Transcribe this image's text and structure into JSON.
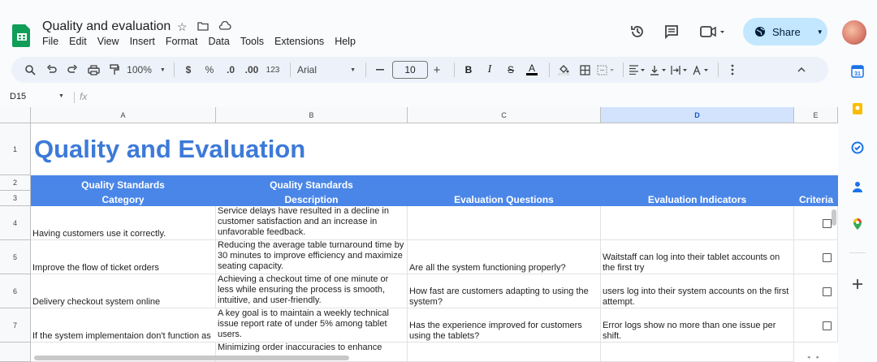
{
  "header": {
    "doc_title": "Quality and evaluation",
    "menu": [
      "File",
      "Edit",
      "View",
      "Insert",
      "Format",
      "Data",
      "Tools",
      "Extensions",
      "Help"
    ],
    "share_label": "Share"
  },
  "toolbar": {
    "zoom": "100%",
    "currency": "$",
    "percent": "%",
    "dec_less": ".0",
    "dec_more": ".00",
    "number_format": "123",
    "font": "Arial",
    "font_size": "10"
  },
  "formula_bar": {
    "name_box": "D15",
    "fx_label": "fx",
    "value": ""
  },
  "columns": [
    "A",
    "B",
    "C",
    "D",
    "E"
  ],
  "rows": [
    "1",
    "2",
    "3",
    "4",
    "5",
    "6",
    "7"
  ],
  "sheet": {
    "title": "Quality and Evaluation",
    "headers": {
      "a_top": "Quality Standards",
      "a_bottom": "Category",
      "b_top": "Quality Standards",
      "b_bottom": "Description",
      "c": "Evaluation Questions",
      "d": "Evaluation Indicators",
      "e": "Criteria"
    },
    "data_rows": [
      {
        "a": "Having customers use it correctly.",
        "b": "Service delays have resulted in a decline in customer satisfaction and an increase in unfavorable feedback.",
        "c": "",
        "d": ""
      },
      {
        "a": "Improve the flow of ticket orders",
        "b": "Reducing the average table turnaround time by 30 minutes to improve efficiency and maximize seating capacity.",
        "c": "Are all the system functioning properly?",
        "d": "Waitstaff can log into their tablet accounts on the first try"
      },
      {
        "a": "Delivery checkout system online",
        "b": "Achieving a checkout time of one minute or less while ensuring the process is smooth, intuitive, and user-friendly.",
        "c": "How fast are customers adapting to using the system?",
        "d": "users log into their system accounts on the first attempt."
      },
      {
        "a": "If the system implementaion don't function as",
        "b": "A key goal is to maintain a weekly technical issue report rate of under 5% among tablet users.",
        "c": "Has the experience improved for customers using the tablets?",
        "d": "Error logs show no more than one issue per shift."
      }
    ],
    "partial_row": {
      "b": "Minimizing order inaccuracies to enhance"
    }
  },
  "colors": {
    "title_blue": "#3d7ad8",
    "header_fill": "#4a86e8",
    "share_bg": "#c2e7ff"
  }
}
